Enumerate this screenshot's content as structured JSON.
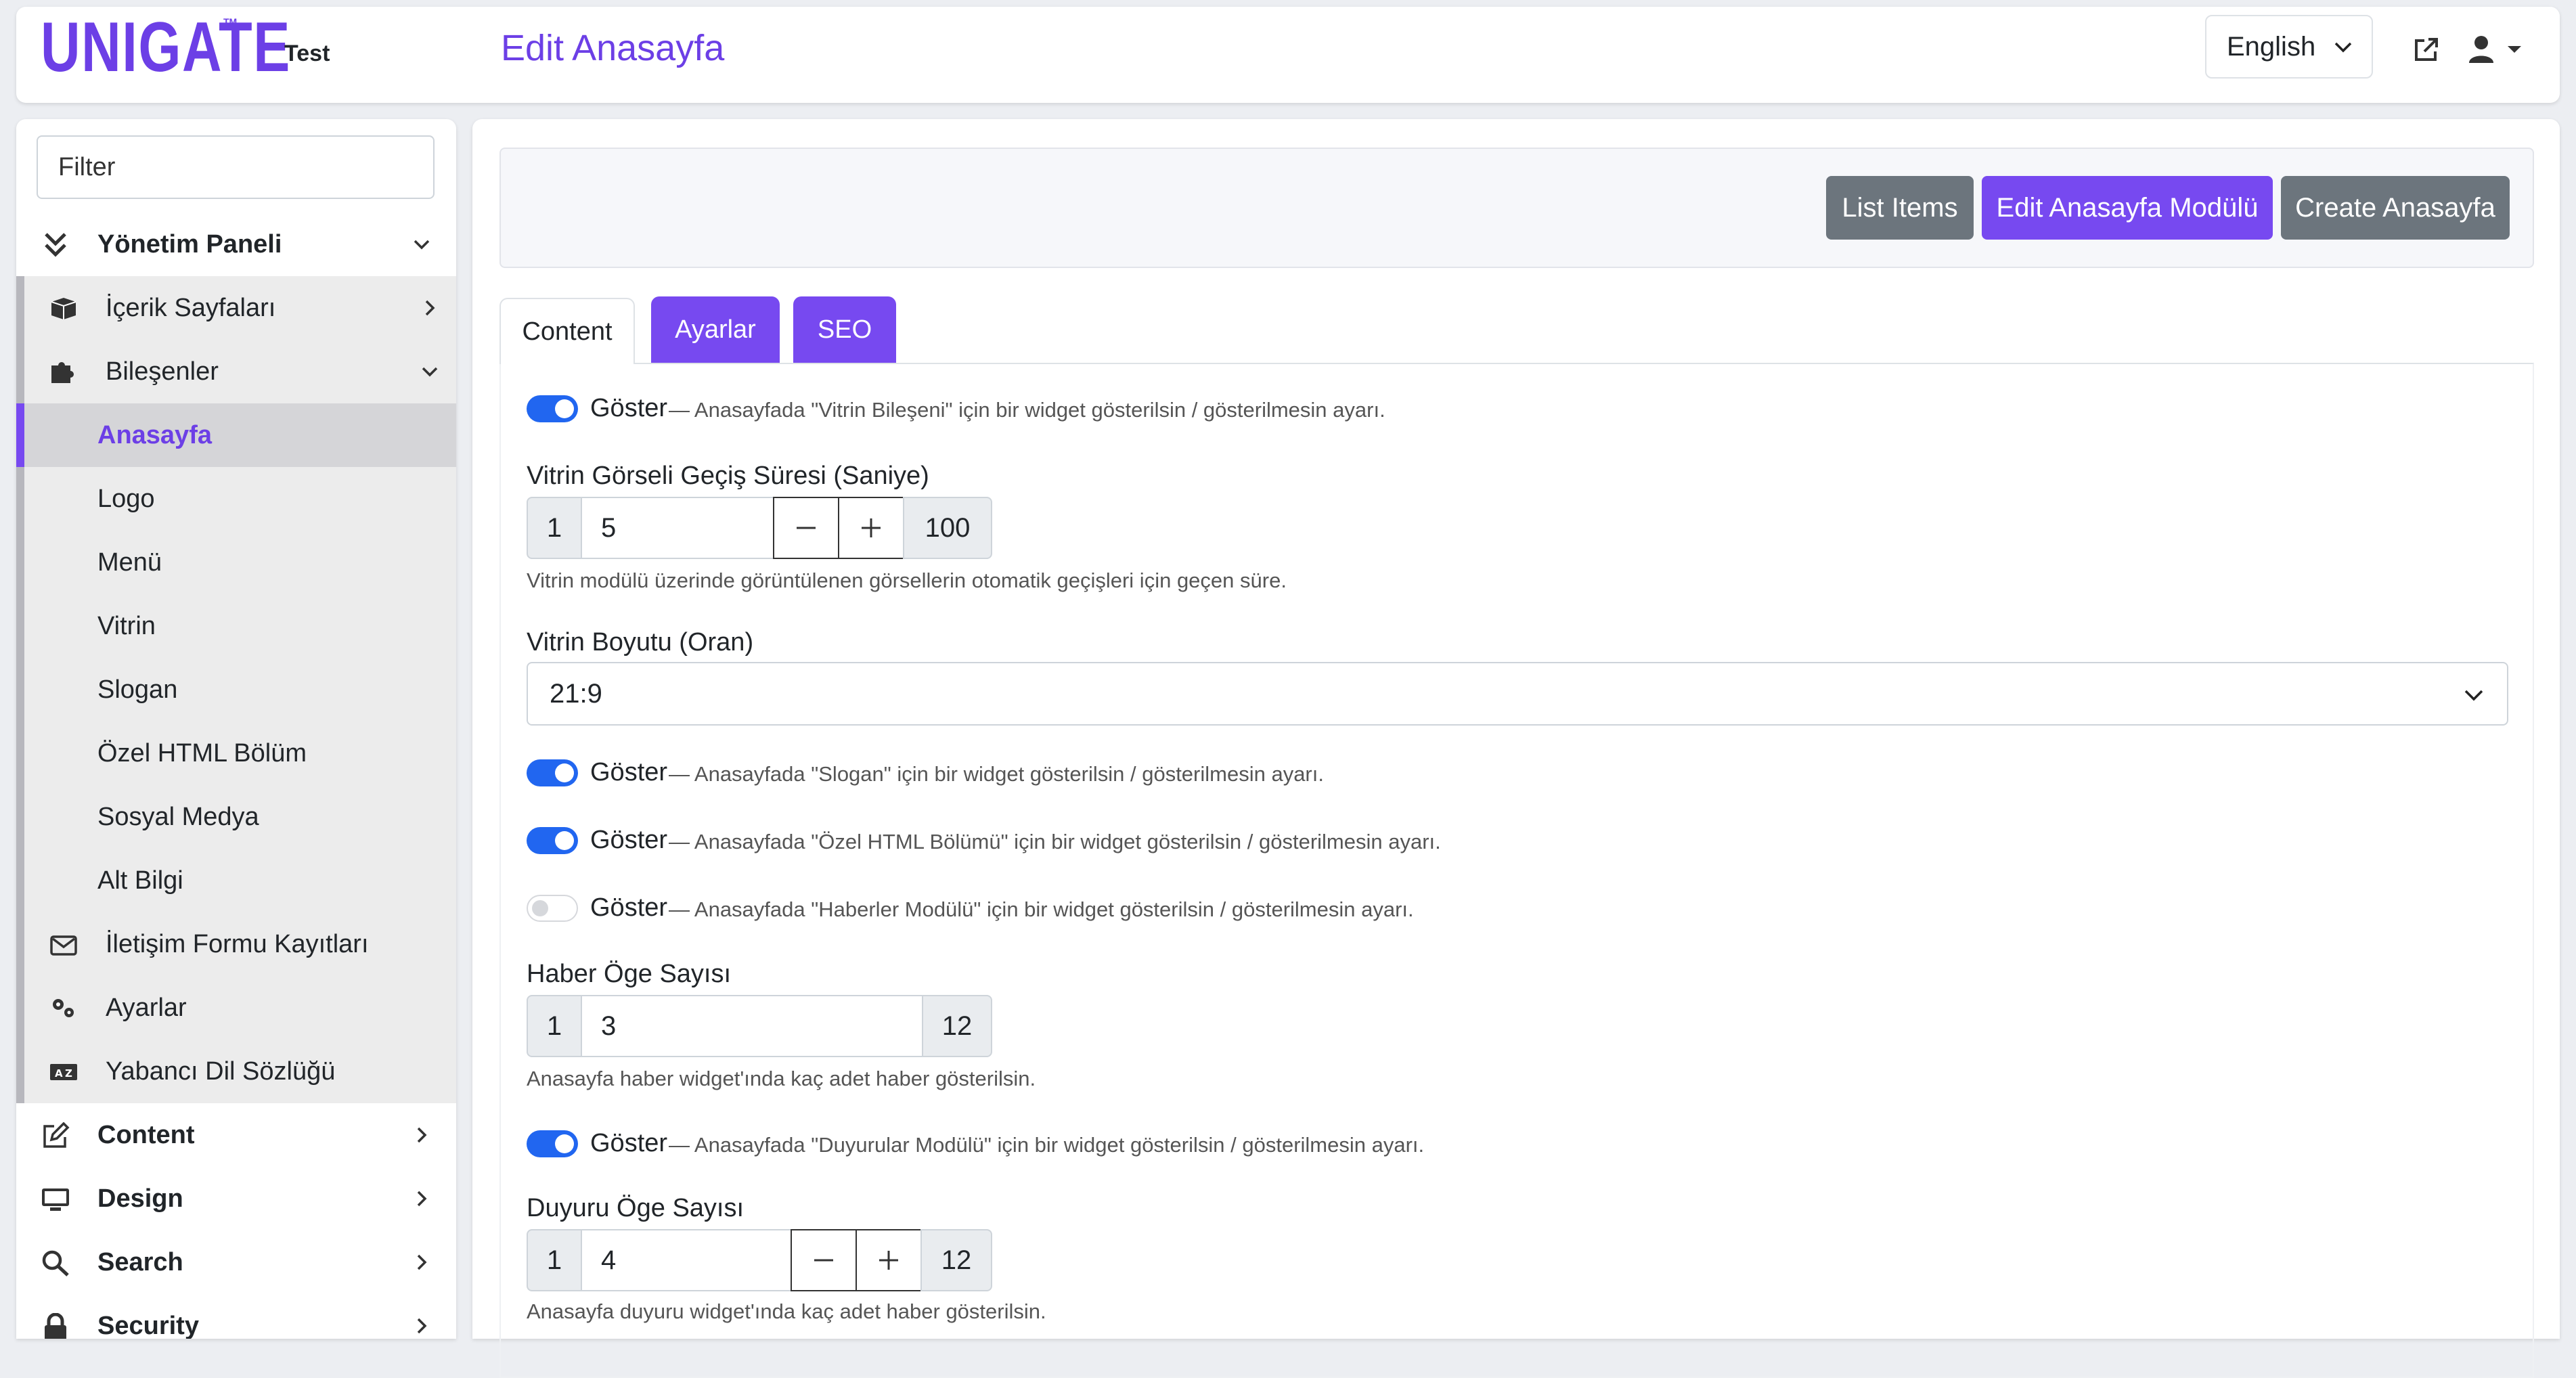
{
  "header": {
    "logo_text": "UNIGATE",
    "logo_tm": "TM",
    "site_name": "Test",
    "page_title": "Edit Anasayfa",
    "language": "English",
    "accent_color": "#6c3fe6"
  },
  "sidebar": {
    "filter_placeholder": "Filter",
    "items": [
      {
        "label": "Yönetim Paneli",
        "icon": "double-chevron-down-icon",
        "arrow": "down"
      },
      {
        "label": "İçerik Sayfaları",
        "icon": "box-icon",
        "arrow": "right"
      },
      {
        "label": "Bileşenler",
        "icon": "puzzle-icon",
        "arrow": "down"
      },
      {
        "label": "Anasayfa"
      },
      {
        "label": "Logo"
      },
      {
        "label": "Menü"
      },
      {
        "label": "Vitrin"
      },
      {
        "label": "Slogan"
      },
      {
        "label": "Özel HTML Bölüm"
      },
      {
        "label": "Sosyal Medya"
      },
      {
        "label": "Alt Bilgi"
      },
      {
        "label": "İletişim Formu Kayıtları",
        "icon": "envelope-icon"
      },
      {
        "label": "Ayarlar",
        "icon": "gears-icon"
      },
      {
        "label": "Yabancı Dil Sözlüğü",
        "icon": "language-icon"
      },
      {
        "label": "Content",
        "icon": "edit-icon",
        "arrow": "right"
      },
      {
        "label": "Design",
        "icon": "monitor-icon",
        "arrow": "right"
      },
      {
        "label": "Search",
        "icon": "search-icon",
        "arrow": "right"
      },
      {
        "label": "Security",
        "icon": "lock-icon",
        "arrow": "right"
      }
    ]
  },
  "actions": {
    "list_items": "List Items",
    "edit_module": "Edit Anasayfa Modülü",
    "create": "Create Anasayfa"
  },
  "tabs": {
    "content": "Content",
    "ayarlar": "Ayarlar",
    "seo": "SEO"
  },
  "form": {
    "vitrin_toggle": {
      "label": "Göster",
      "desc": "— Anasayfada \"Vitrin Bileşeni\" için bir widget gösterilsin / gösterilmesin ayarı.",
      "on": true
    },
    "vitrin_duration": {
      "label": "Vitrin Görseli Geçiş Süresi (Saniye)",
      "min": "1",
      "value": "5",
      "max": "100",
      "help": "Vitrin modülü üzerinde görüntülenen görsellerin otomatik geçişleri için geçen süre."
    },
    "vitrin_ratio": {
      "label": "Vitrin Boyutu (Oran)",
      "value": "21:9"
    },
    "slogan_toggle": {
      "label": "Göster",
      "desc": "— Anasayfada \"Slogan\" için bir widget gösterilsin / gösterilmesin ayarı.",
      "on": true
    },
    "html_toggle": {
      "label": "Göster",
      "desc": "— Anasayfada \"Özel HTML Bölümü\" için bir widget gösterilsin / gösterilmesin ayarı.",
      "on": true
    },
    "news_toggle": {
      "label": "Göster",
      "desc": "— Anasayfada \"Haberler Modülü\" için bir widget gösterilsin / gösterilmesin ayarı.",
      "on": false
    },
    "news_count": {
      "label": "Haber Öge Sayısı",
      "min": "1",
      "value": "3",
      "max": "12",
      "help": "Anasayfa haber widget'ında kaç adet haber gösterilsin."
    },
    "announce_toggle": {
      "label": "Göster",
      "desc": "— Anasayfada \"Duyurular Modülü\" için bir widget gösterilsin / gösterilmesin ayarı.",
      "on": true
    },
    "announce_count": {
      "label": "Duyuru Öge Sayısı",
      "min": "1",
      "value": "4",
      "max": "12",
      "help": "Anasayfa duyuru widget'ında kaç adet haber gösterilsin."
    }
  }
}
